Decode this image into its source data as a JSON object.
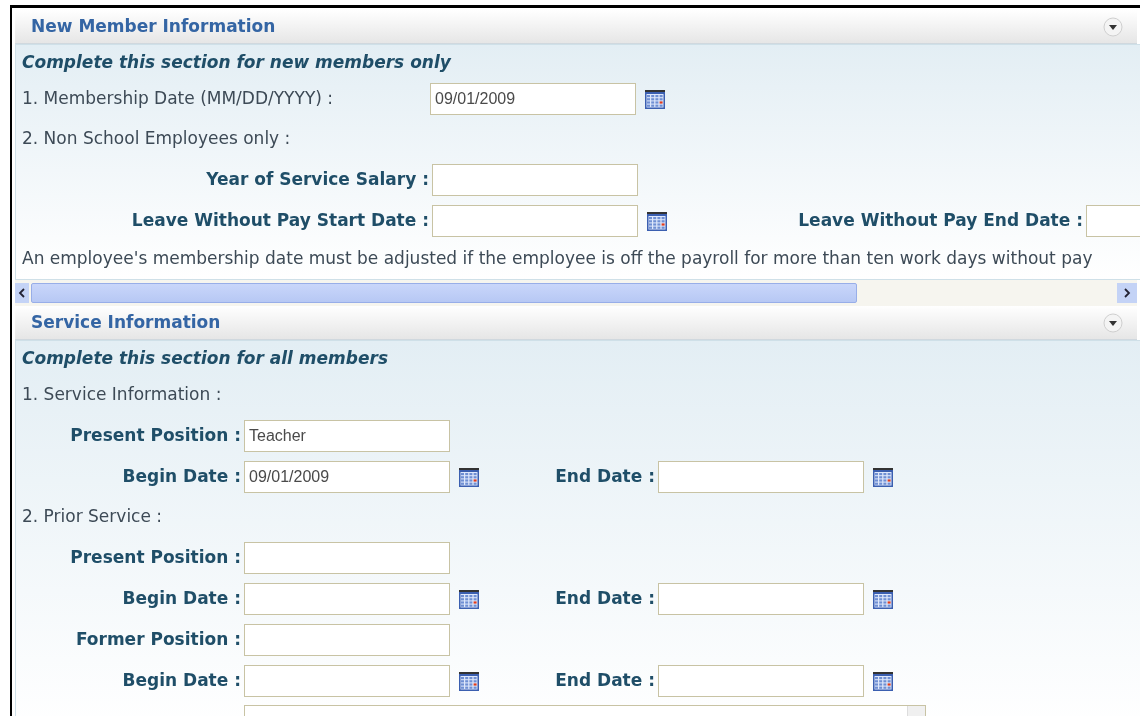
{
  "sections": [
    {
      "title": "New Member Information",
      "subtitle": "Complete this section for new members only",
      "rows": [
        {
          "kind": "numbered",
          "text": "1. Membership Date (MM/DD/YYYY) :",
          "field": {
            "value": "09/01/2009",
            "calendar": true
          }
        },
        {
          "kind": "numbered",
          "text": "2. Non School Employees only :"
        },
        {
          "kind": "fields",
          "fields": [
            {
              "label": "Year of Service Salary :",
              "calendar": false
            }
          ]
        },
        {
          "kind": "fields",
          "fields": [
            {
              "label": "Leave Without Pay Start Date :",
              "calendar": true
            },
            {
              "label": "Leave Without Pay End Date :",
              "calendar": false
            }
          ]
        },
        {
          "kind": "note",
          "text": "An employee's membership date must be adjusted if the employee is off the payroll for more than ten work days without pay"
        }
      ],
      "scrollbar": true
    },
    {
      "title": "Service Information",
      "subtitle": "Complete this section for all members",
      "rows": [
        {
          "kind": "numbered",
          "text": "1. Service Information :"
        },
        {
          "kind": "fields",
          "fields": [
            {
              "label": "Present Position :",
              "value": "Teacher",
              "calendar": false
            }
          ]
        },
        {
          "kind": "fields",
          "fields": [
            {
              "label": "Begin Date :",
              "value": "09/01/2009",
              "calendar": true
            },
            {
              "label": "End Date :",
              "calendar": true
            }
          ]
        },
        {
          "kind": "numbered",
          "text": "2. Prior Service :"
        },
        {
          "kind": "fields",
          "fields": [
            {
              "label": "Present Position :",
              "calendar": false
            }
          ]
        },
        {
          "kind": "fields",
          "fields": [
            {
              "label": "Begin Date :",
              "calendar": true
            },
            {
              "label": "End Date :",
              "calendar": true
            }
          ]
        },
        {
          "kind": "fields",
          "fields": [
            {
              "label": "Former Position :",
              "calendar": false
            }
          ]
        },
        {
          "kind": "fields",
          "fields": [
            {
              "label": "Begin Date :",
              "calendar": true
            },
            {
              "label": "End Date :",
              "calendar": true
            }
          ]
        },
        {
          "kind": "textarea"
        }
      ],
      "scrollbar": false
    }
  ]
}
